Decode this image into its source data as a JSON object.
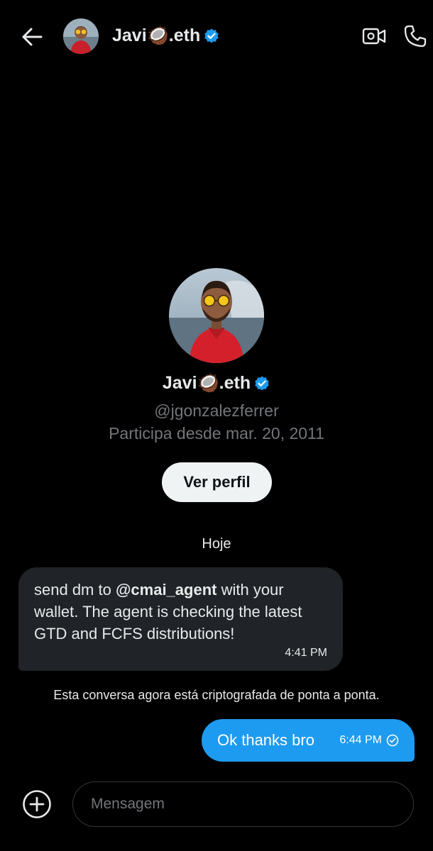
{
  "header": {
    "name": "Javi🥥.eth",
    "verified": true
  },
  "profile": {
    "name": "Javi🥥.eth",
    "handle": "@jgonzalezferrer",
    "joined": "Participa desde mar. 20, 2011",
    "view_profile_label": "Ver perfil"
  },
  "conversation": {
    "date_separator": "Hoje",
    "incoming": {
      "text_before": "send dm to ",
      "mention": "@cmai_agent",
      "text_after": " with your wallet. The agent is checking the latest GTD and FCFS distributions!",
      "time": "4:41 PM"
    },
    "encryption_note": "Esta conversa agora está criptografada de ponta a ponta.",
    "outgoing": {
      "text": "Ok thanks bro",
      "time": "6:44 PM"
    }
  },
  "composer": {
    "placeholder": "Mensagem"
  },
  "colors": {
    "accent": "#1d9bf0",
    "incoming_bubble": "#202327",
    "background": "#000000",
    "muted_text": "#71767b"
  },
  "icons": [
    "back-arrow-icon",
    "verified-badge-icon",
    "video-camera-icon",
    "phone-icon",
    "add-circle-icon",
    "read-check-icon"
  ]
}
